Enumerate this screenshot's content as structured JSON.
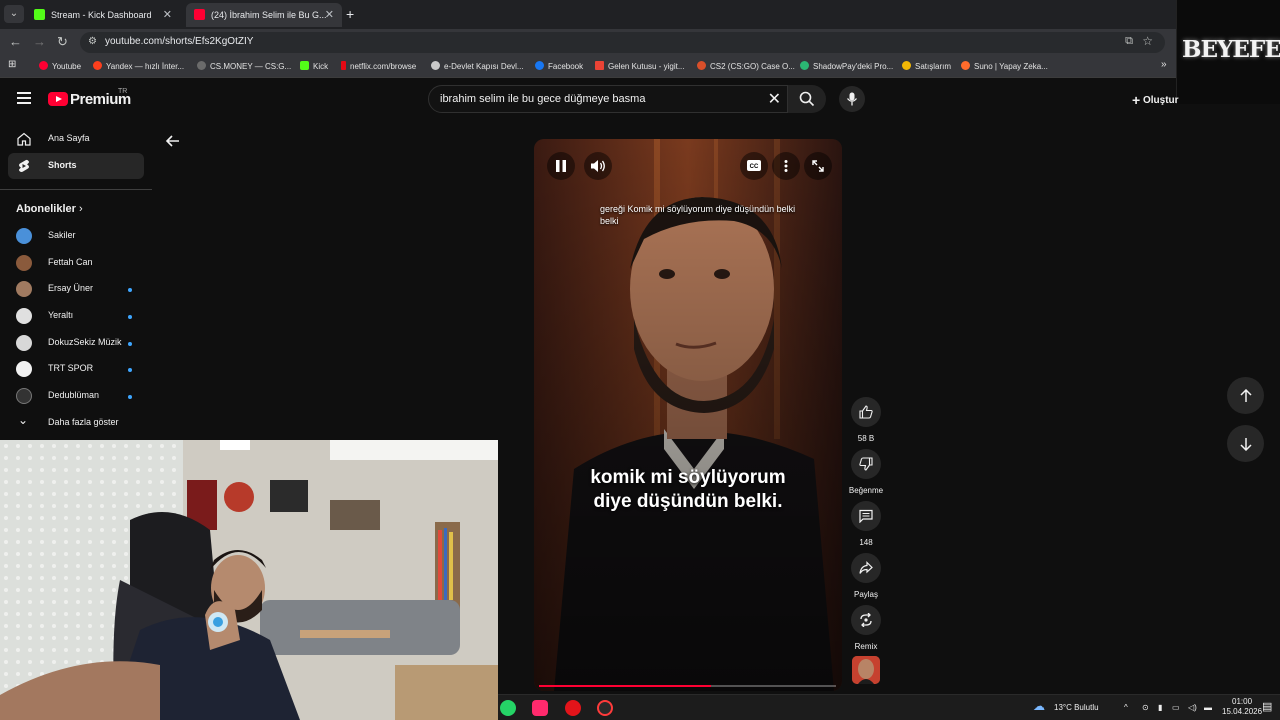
{
  "browser": {
    "tabs": [
      {
        "title": "Stream - Kick Dashboard",
        "favicon_color": "#53fc18",
        "active": false
      },
      {
        "title": "(24) İbrahim Selim ile Bu G...",
        "favicon_color": "#ff0033",
        "active": true
      }
    ],
    "url": "youtube.com/shorts/Efs2KgOtZIY",
    "bookmarks": [
      {
        "label": "Youtube",
        "color": "#ff0033"
      },
      {
        "label": "Yandex — hızlı İnter...",
        "color": "#fc3f1d"
      },
      {
        "label": "CS.MONEY — CS:G...",
        "color": "#6b6b6b"
      },
      {
        "label": "Kick",
        "color": "#53fc18"
      },
      {
        "label": "netflix.com/browse",
        "color": "#e50914"
      },
      {
        "label": "e-Devlet Kapısı Devl...",
        "color": "#c9c9c9"
      },
      {
        "label": "Facebook",
        "color": "#1877f2"
      },
      {
        "label": "Gelen Kutusu - yigit...",
        "color": "#ea4335"
      },
      {
        "label": "CS2 (CS:GO) Case O...",
        "color": "#d94f2a"
      },
      {
        "label": "ShadowPay'deki Pro...",
        "color": "#2bb673"
      },
      {
        "label": "Satışlarım",
        "color": "#f2b705"
      },
      {
        "label": "Suno | Yapay Zeka...",
        "color": "#ff6b2c"
      }
    ]
  },
  "overlay_logo": "BEYEFENDİ",
  "youtube": {
    "logo": "Premium",
    "logo_country": "TR",
    "search_query": "ibrahim selim ile bu gece düğmeye basma",
    "create_label": "Oluştur"
  },
  "sidebar": {
    "items": [
      {
        "label": "Ana Sayfa",
        "icon": "home-icon"
      },
      {
        "label": "Shorts",
        "icon": "shorts-icon"
      }
    ],
    "subscriptions_title": "Abonelikler",
    "subscriptions": [
      {
        "name": "Sakiler",
        "color": "#4a90d9",
        "new": false
      },
      {
        "name": "Fettah Can",
        "color": "#8a5a3c",
        "new": false
      },
      {
        "name": "Ersay Üner",
        "color": "#a07a60",
        "new": true
      },
      {
        "name": "Yeraltı",
        "color": "#e0e0e0",
        "new": true
      },
      {
        "name": "DokuzSekiz Müzik",
        "color": "#d8d8d8",
        "new": true
      },
      {
        "name": "TRT SPOR",
        "color": "#f1f1f1",
        "new": true
      },
      {
        "name": "Dedublüman",
        "color": "#333333",
        "new": true
      }
    ],
    "show_more": "Daha fazla göster"
  },
  "player": {
    "subtitle_top": "gereği Komik mi söylüyorum diye düşündün belki",
    "subtitle_top_tail": "belki",
    "subtitle_line1": "komik mi söylüyorum",
    "subtitle_line2": "diye düşündün belki.",
    "progress": 0.58
  },
  "actions": {
    "likes": "58 B",
    "dislike": "Beğenme",
    "comments": "148",
    "share": "Paylaş",
    "remix": "Remix"
  },
  "taskbar": {
    "weather": "13°C  Bulutlu",
    "time": "01:00",
    "date": "15.04.2026"
  }
}
